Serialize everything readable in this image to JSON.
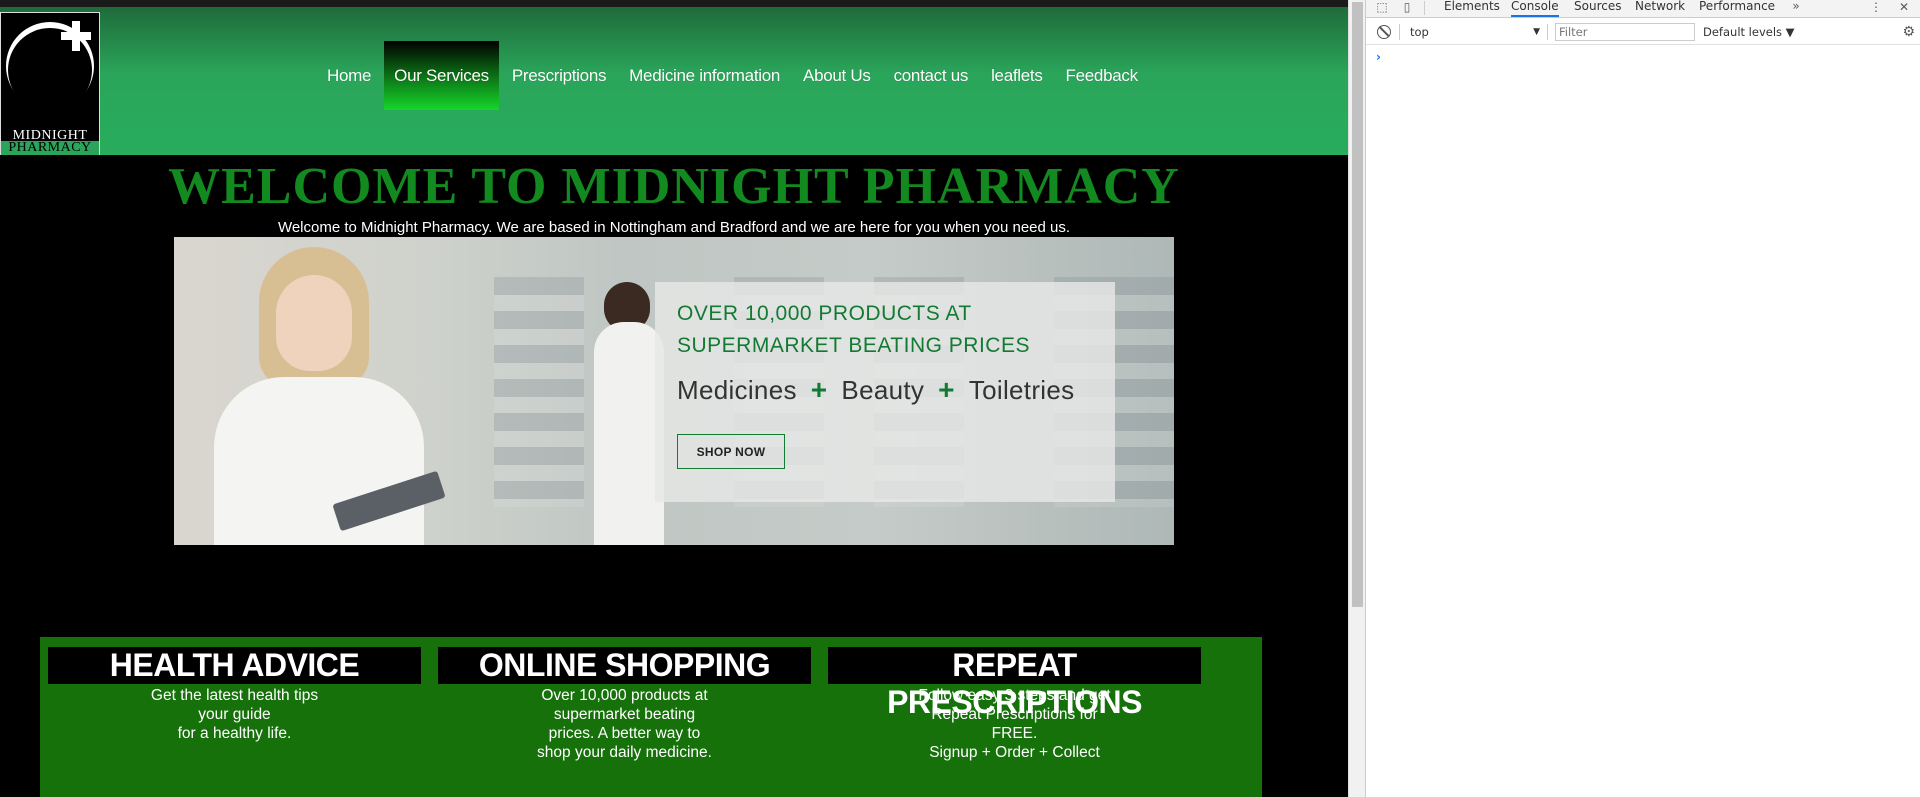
{
  "logo": {
    "line1": "MIDNIGHT",
    "line2": "PHARMACY"
  },
  "nav": {
    "items": [
      {
        "label": "Home"
      },
      {
        "label": "Our Services",
        "active": true
      },
      {
        "label": "Prescriptions"
      },
      {
        "label": "Medicine information"
      },
      {
        "label": "About Us"
      },
      {
        "label": "contact us"
      },
      {
        "label": "leaflets"
      },
      {
        "label": "Feedback"
      }
    ]
  },
  "welcome": {
    "title": "WELCOME TO MIDNIGHT PHARMACY",
    "subtitle": "Welcome to Midnight Pharmacy. We are based in Nottingham and Bradford and we are here for you when you need us."
  },
  "hero": {
    "headline_line1": "OVER 10,000 PRODUCTS AT",
    "headline_line2": "SUPERMARKET BEATING PRICES",
    "categories": [
      "Medicines",
      "Beauty",
      "Toiletries"
    ],
    "plus": "+",
    "cta": "SHOP NOW"
  },
  "features": [
    {
      "title": "HEALTH ADVICE",
      "lines": [
        "Get the latest health tips",
        "your guide",
        "for a healthy life."
      ]
    },
    {
      "title": "ONLINE SHOPPING",
      "lines": [
        "Over 10,000 products at",
        "supermarket beating",
        "prices. A better way to",
        "shop your daily medicine."
      ]
    },
    {
      "title": "REPEAT PRESCRIPTIONS",
      "lines": [
        "Follow easy 3 steps and get",
        "Repeat Prescriptions for",
        "FREE.",
        "Signup + Order + Collect"
      ]
    }
  ],
  "devtools": {
    "tabs": [
      "Elements",
      "Console",
      "Sources",
      "Network",
      "Performance"
    ],
    "active_tab": "Console",
    "more_tabs": "»",
    "menu": "⋮",
    "close": "✕",
    "context": "top",
    "filter_placeholder": "Filter",
    "levels": "Default levels ▼",
    "prompt": "›",
    "accent": "#1a73e8"
  },
  "colors": {
    "header_green": "#2aa55a",
    "title_green": "#138a1f",
    "feature_green": "#16710a"
  }
}
